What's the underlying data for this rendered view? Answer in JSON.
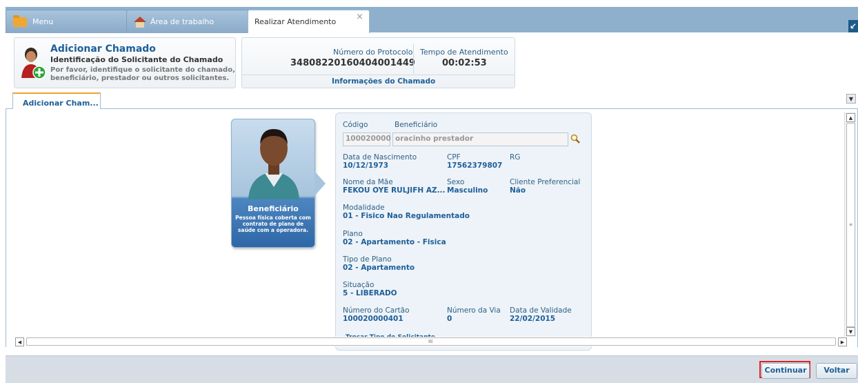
{
  "tabs": {
    "menu": "Menu",
    "area": "Área de trabalho",
    "atendimento": "Realizar Atendimento",
    "close": "×"
  },
  "header": {
    "title": "Adicionar Chamado",
    "subtitle": "Identificação do Solicitante do Chamado",
    "desc1": "Por favor, identifique o solicitante do chamado,",
    "desc2": "beneficiário, prestador ou outros solicitantes.",
    "protocol_label": "Número do Protocolo",
    "protocol_value": "34808220160404001449",
    "time_label": "Tempo de Atendimento",
    "time_value": "00:02:53",
    "info_label": "Informações do Chamado"
  },
  "content_tab": "Adicionar Cham...",
  "card": {
    "title": "Beneficiário",
    "desc": "Pessoa física coberta com contrato de plano de saúde com a operadora."
  },
  "details": {
    "codigo_label": "Código",
    "beneficiario_label": "Beneficiário",
    "codigo_value": "100020000",
    "beneficiario_value": "oracinho prestador",
    "nasc_label": "Data de Nascimento",
    "nasc_value": "10/12/1973",
    "cpf_label": "CPF",
    "cpf_value": "17562379807",
    "rg_label": "RG",
    "mae_label": "Nome da Mãe",
    "mae_value": "FEKOU OYE RULJIFH AZ...",
    "sexo_label": "Sexo",
    "sexo_value": "Masculino",
    "pref_label": "Cliente Preferencial",
    "pref_value": "Não",
    "modalidade_label": "Modalidade",
    "modalidade_value": "01 - Fisico Nao Regulamentado",
    "plano_label": "Plano",
    "plano_value": "02 - Apartamento - Fisica",
    "tipo_label": "Tipo de Plano",
    "tipo_value": "02 - Apartamento",
    "situacao_label": "Situação",
    "situacao_value": "5 - LIBERADO",
    "cartao_label": "Número do Cartão",
    "cartao_value": "100020000401",
    "via_label": "Número da Via",
    "via_value": "0",
    "validade_label": "Data de Validade",
    "validade_value": "22/02/2015",
    "trocar": "Trocar Tipo do Solicitante"
  },
  "footer": {
    "continuar": "Continuar",
    "voltar": "Voltar"
  },
  "colors": {
    "accent": "#1e5e98",
    "tabbar": "#8fb0cc",
    "highlight": "#e02020"
  }
}
